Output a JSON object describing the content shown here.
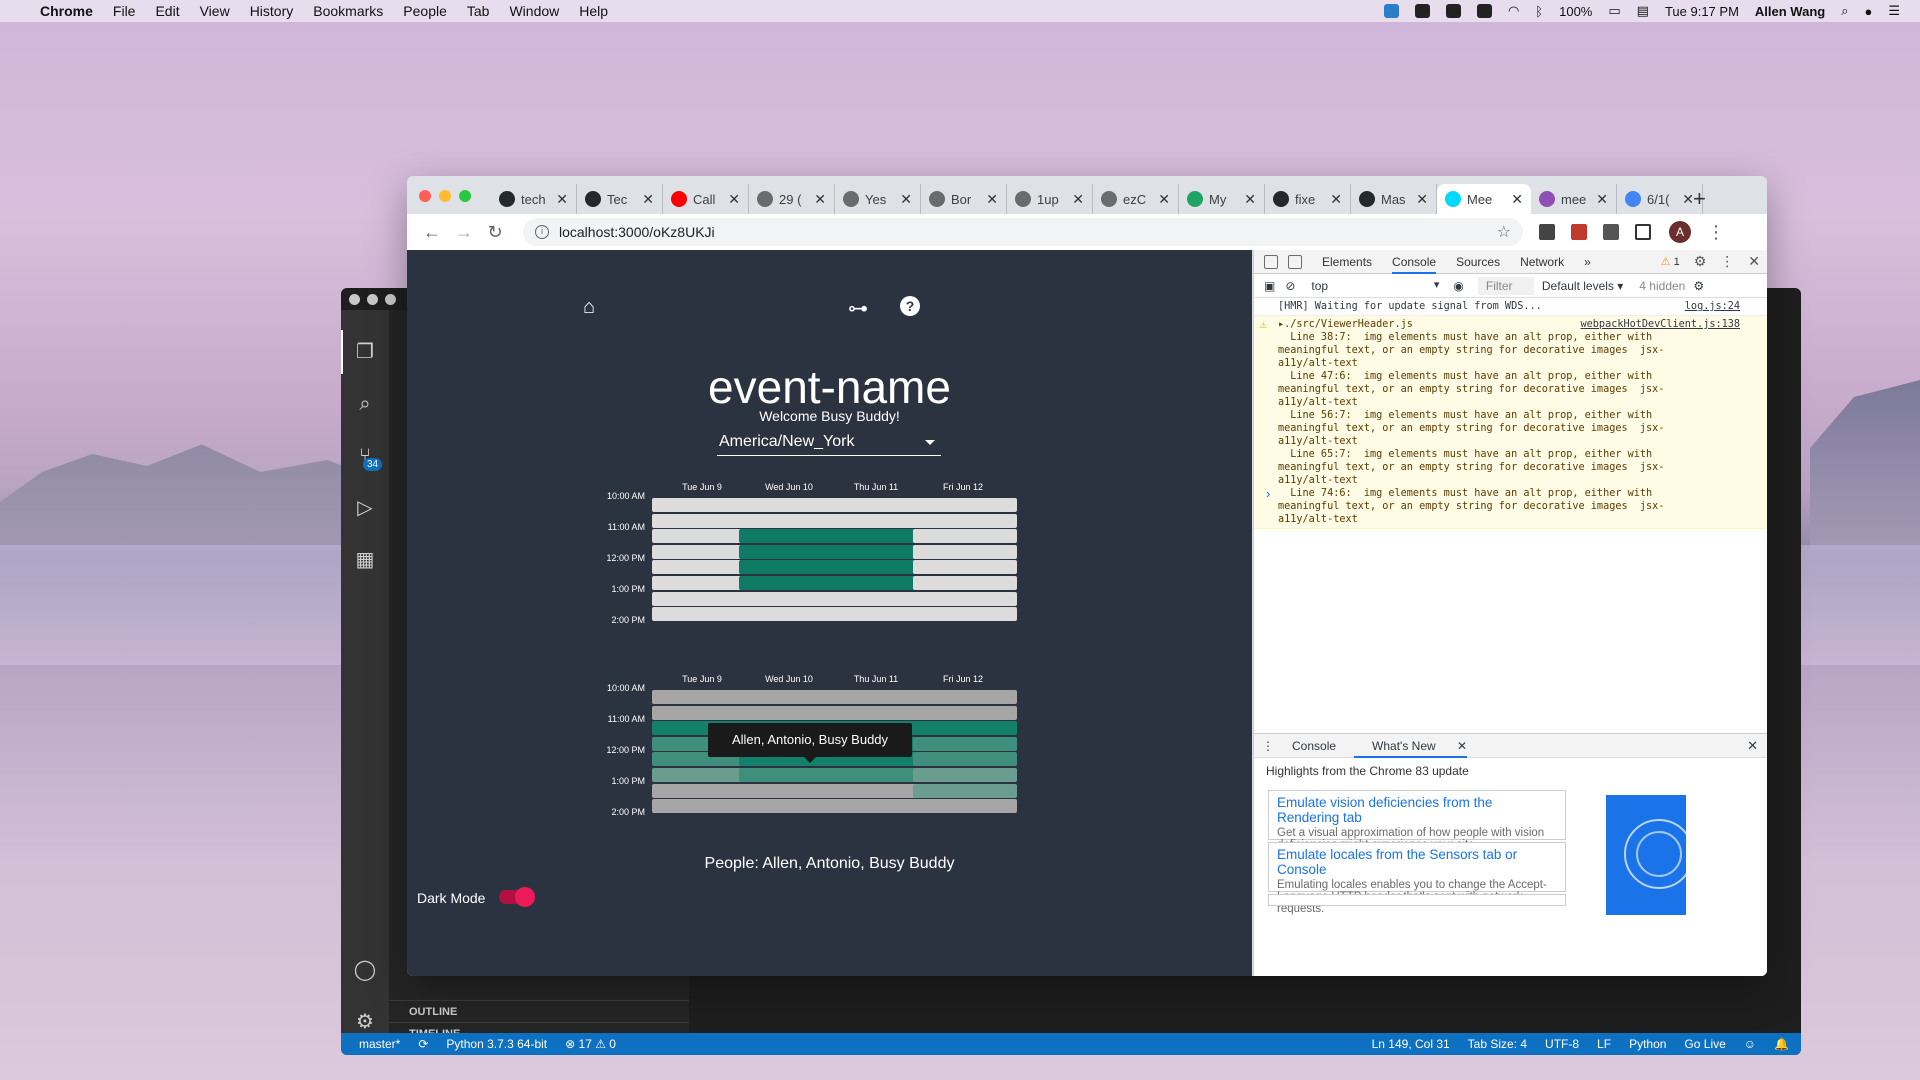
{
  "menubar": {
    "app": "Chrome",
    "items": [
      "File",
      "Edit",
      "View",
      "History",
      "Bookmarks",
      "People",
      "Tab",
      "Window",
      "Help"
    ],
    "battery": "100%",
    "clock": "Tue 9:17 PM",
    "user": "Allen Wang"
  },
  "vscode": {
    "scm_badge": "34",
    "sections": [
      "OUTLINE",
      "TIMELINE"
    ],
    "status": {
      "branch": "master*",
      "python": "Python 3.7.3 64-bit",
      "problems": "⊗ 17 ⚠ 0",
      "cursor": "Ln 149, Col 31",
      "tabsize": "Tab Size: 4",
      "encoding": "UTF-8",
      "eol": "LF",
      "lang": "Python",
      "golive": "Go Live"
    }
  },
  "chrome": {
    "tabs": [
      {
        "title": "tech",
        "color": "#24292e"
      },
      {
        "title": "Tec",
        "color": "#24292e"
      },
      {
        "title": "Call",
        "color": "#ff0000"
      },
      {
        "title": "29 (",
        "color": "#6b6b6b"
      },
      {
        "title": "Yes",
        "color": "#6b6b6b"
      },
      {
        "title": "Bor",
        "color": "#6b6b6b"
      },
      {
        "title": "1up",
        "color": "#6b6b6b"
      },
      {
        "title": "ezC",
        "color": "#6b6b6b"
      },
      {
        "title": "My",
        "color": "#1fa463"
      },
      {
        "title": "fixe",
        "color": "#24292e"
      },
      {
        "title": "Mas",
        "color": "#24292e"
      },
      {
        "title": "Mee",
        "color": "#00d8ff",
        "active": true
      },
      {
        "title": "mee",
        "color": "#8f4fb3"
      },
      {
        "title": "6/1(",
        "color": "#4285f4"
      }
    ],
    "url": "localhost:3000/oKz8UKJi"
  },
  "app": {
    "title": "event-name",
    "welcome": "Welcome Busy Buddy!",
    "timezone": "America/New_York",
    "days": [
      "Tue Jun 9",
      "Wed Jun 10",
      "Thu Jun 11",
      "Fri Jun 12"
    ],
    "times": [
      "10:00 AM",
      "11:00 AM",
      "12:00 PM",
      "1:00 PM",
      "2:00 PM"
    ],
    "my_availability": [
      [
        0,
        0,
        0,
        0
      ],
      [
        0,
        0,
        0,
        0
      ],
      [
        0,
        1,
        1,
        0
      ],
      [
        0,
        1,
        1,
        0
      ],
      [
        0,
        1,
        1,
        0
      ],
      [
        0,
        1,
        1,
        0
      ],
      [
        0,
        0,
        0,
        0
      ],
      [
        0,
        0,
        0,
        0
      ]
    ],
    "group_availability": [
      [
        0,
        0,
        0,
        0
      ],
      [
        0,
        0,
        0,
        0
      ],
      [
        3,
        3,
        3,
        3
      ],
      [
        2,
        3,
        3,
        2
      ],
      [
        2,
        3,
        3,
        2
      ],
      [
        1,
        2,
        2,
        1
      ],
      [
        0,
        0,
        0,
        1
      ],
      [
        0,
        0,
        0,
        0
      ]
    ],
    "tooltip": "Allen, Antonio, Busy Buddy",
    "people": "People: Allen, Antonio, Busy Buddy",
    "dark_mode_label": "Dark Mode",
    "dark_mode_on": true,
    "colors": {
      "bg": "#2c3340",
      "empty": "#dcdcdc",
      "mine": "#0e7a64",
      "group0": "#a6a6a6",
      "group1": "#6b9c90",
      "group2": "#3f8f7c",
      "group3": "#13806a"
    }
  },
  "devtools": {
    "tabs": [
      "Elements",
      "Console",
      "Sources",
      "Network"
    ],
    "active_tab": "Console",
    "warnings": "1",
    "context": "top",
    "filter_placeholder": "Filter",
    "levels": "Default levels ▾",
    "hidden": "4 hidden",
    "log1": {
      "text": "[HMR] Waiting for update signal from WDS...",
      "src": "log.js:24"
    },
    "log2": {
      "head": "▸./src/ViewerHeader.js",
      "src": "webpackHotDevClient.js:138",
      "body": "  Line 38:7:  img elements must have an alt prop, either with\nmeaningful text, or an empty string for decorative images  jsx-\na11y/alt-text\n  Line 47:6:  img elements must have an alt prop, either with\nmeaningful text, or an empty string for decorative images  jsx-\na11y/alt-text\n  Line 56:7:  img elements must have an alt prop, either with\nmeaningful text, or an empty string for decorative images  jsx-\na11y/alt-text\n  Line 65:7:  img elements must have an alt prop, either with\nmeaningful text, or an empty string for decorative images  jsx-\na11y/alt-text\n  Line 74:6:  img elements must have an alt prop, either with\nmeaningful text, or an empty string for decorative images  jsx-\na11y/alt-text"
    },
    "drawer": {
      "tab1": "Console",
      "tab2": "What's New",
      "highlights": "Highlights from the Chrome 83 update",
      "cards": [
        {
          "title": "Emulate vision deficiencies from the Rendering tab",
          "desc": "Get a visual approximation of how people with vision deficiencies might experience your site."
        },
        {
          "title": "Emulate locales from the Sensors tab or Console",
          "desc": "Emulating locales enables you to change the Accept-Language HTTP header that's sent with network requests."
        }
      ]
    }
  }
}
